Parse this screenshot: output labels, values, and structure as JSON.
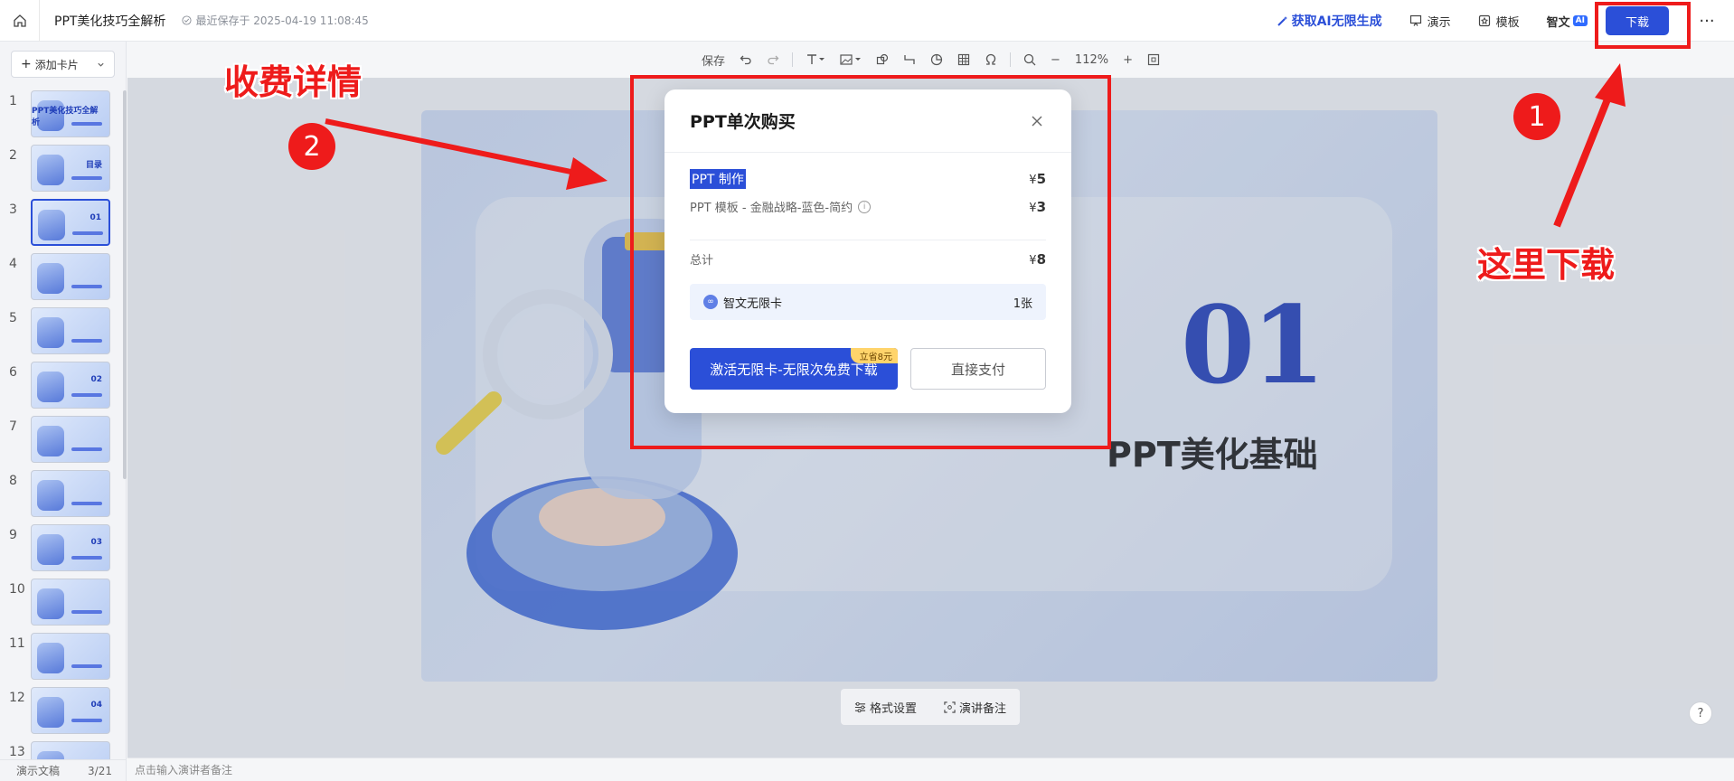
{
  "header": {
    "doc_title": "PPT美化技巧全解析",
    "save_status": "最近保存于 2025-04-19 11:08:45",
    "ai_link": "获取AI无限生成",
    "present_label": "演示",
    "template_label": "模板",
    "zhiwen_label": "智文",
    "ai_badge": "AI",
    "download_label": "下载",
    "more_label": "···"
  },
  "sidebar": {
    "add_card_label": "添加卡片",
    "slides": [
      {
        "num": "1",
        "text": "PPT美化技巧全解析"
      },
      {
        "num": "2",
        "text": "目录"
      },
      {
        "num": "3",
        "text": "01"
      },
      {
        "num": "4",
        "text": ""
      },
      {
        "num": "5",
        "text": ""
      },
      {
        "num": "6",
        "text": "02"
      },
      {
        "num": "7",
        "text": ""
      },
      {
        "num": "8",
        "text": ""
      },
      {
        "num": "9",
        "text": "03"
      },
      {
        "num": "10",
        "text": ""
      },
      {
        "num": "11",
        "text": ""
      },
      {
        "num": "12",
        "text": "04"
      },
      {
        "num": "13",
        "text": ""
      }
    ],
    "active_slide": 3,
    "footer_label": "演示文稿",
    "footer_page": "3/21"
  },
  "toolbar": {
    "save_label": "保存",
    "zoom": "112%"
  },
  "slide": {
    "number": "01",
    "title": "PPT美化基础"
  },
  "bottom": {
    "format_label": "格式设置",
    "notes_label": "演讲备注",
    "notes_placeholder": "点击输入演讲者备注",
    "help_label": "?"
  },
  "modal": {
    "title": "PPT单次购买",
    "item1_label": "PPT 制作",
    "item1_currency": "¥",
    "item1_price": "5",
    "item2_label": "PPT 模板 - 金融战略-蓝色-简约",
    "item2_currency": "¥",
    "item2_price": "3",
    "total_label": "总计",
    "total_currency": "¥",
    "total_price": "8",
    "card_label": "智文无限卡",
    "card_count": "1张",
    "activate_label": "激活无限卡-无限次免费下载",
    "save_tag": "立省8元",
    "direct_label": "直接支付"
  },
  "annotations": {
    "fee_label": "收费详情",
    "download_here": "这里下载",
    "step1": "1",
    "step2": "2"
  },
  "colors": {
    "primary": "#2b4fd8",
    "annotation_red": "#ee1b1b",
    "save_tag_bg": "#ffd46b"
  }
}
